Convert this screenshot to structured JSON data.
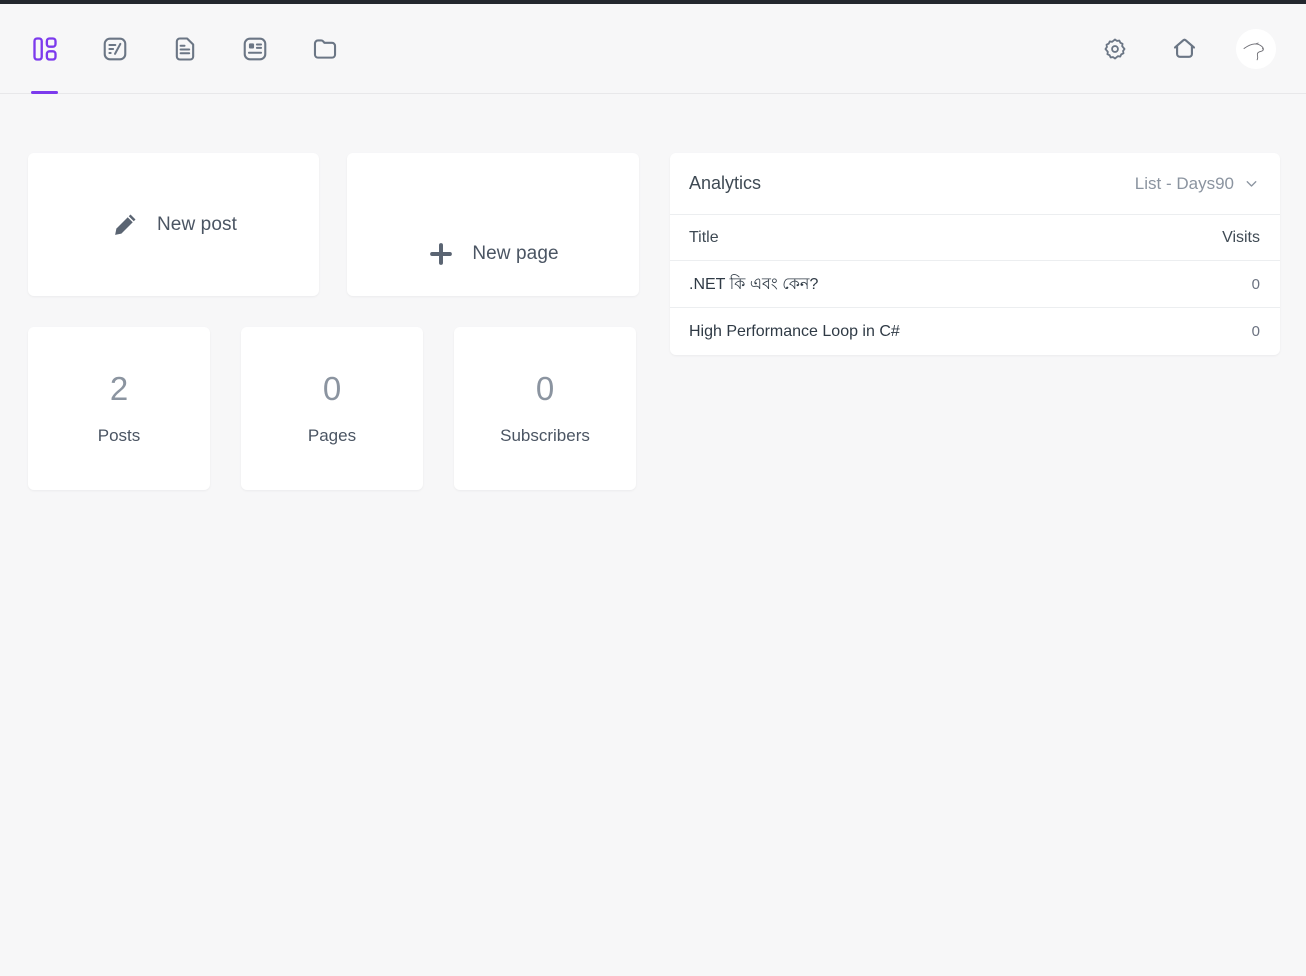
{
  "window": {
    "accent_color": "#7c3aed",
    "background_color": "#f7f7f8",
    "card_color": "#ffffff",
    "icon_color": "#6b7685",
    "titlebar_color": "#23272e"
  },
  "header": {
    "nav_items": [
      {
        "name": "dashboard",
        "icon": "dashboard-icon",
        "active": true
      },
      {
        "name": "posts",
        "icon": "posts-edit-icon",
        "active": false
      },
      {
        "name": "pages",
        "icon": "page-document-icon",
        "active": false
      },
      {
        "name": "subscribers",
        "icon": "contact-card-icon",
        "active": false
      },
      {
        "name": "files",
        "icon": "folder-icon",
        "active": false
      }
    ],
    "actions": [
      {
        "name": "settings",
        "icon": "gear-icon"
      },
      {
        "name": "home",
        "icon": "home-icon"
      },
      {
        "name": "account",
        "icon": "avatar-bird-icon"
      }
    ]
  },
  "quick_actions": [
    {
      "label": "New post",
      "icon": "pencil-icon"
    },
    {
      "label": "New page",
      "icon": "plus-icon"
    }
  ],
  "stats": [
    {
      "value": "2",
      "label": "Posts"
    },
    {
      "value": "0",
      "label": "Pages"
    },
    {
      "value": "0",
      "label": "Subscribers"
    }
  ],
  "analytics": {
    "title": "Analytics",
    "filter_label": "List - Days90",
    "filter_icon": "chevron-down-icon",
    "columns": {
      "title": "Title",
      "visits": "Visits"
    },
    "rows": [
      {
        "title": ".NET কি এবং কেন?",
        "visits": "0"
      },
      {
        "title": "High Performance Loop in C#",
        "visits": "0"
      }
    ]
  }
}
